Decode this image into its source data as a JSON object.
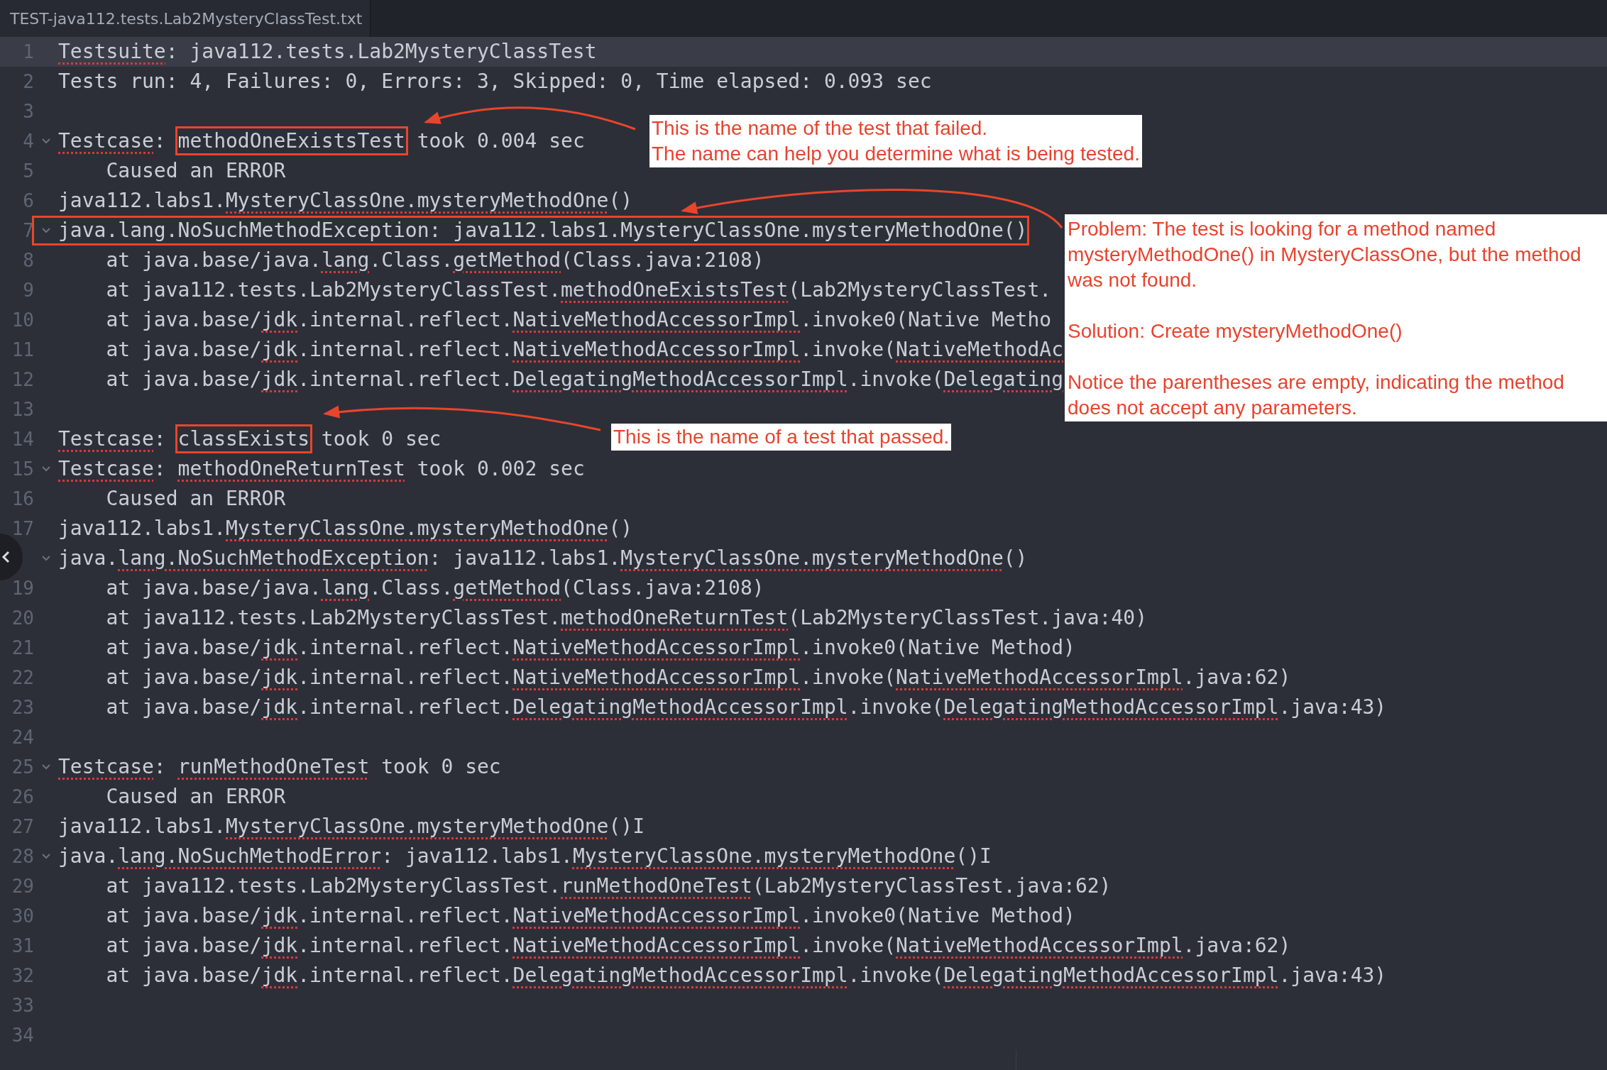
{
  "tab": {
    "title": "TEST-java112.tests.Lab2MysteryClassTest.txt",
    "selected": true
  },
  "lines": [
    {
      "number": "1",
      "current": true,
      "foldable": false,
      "highlighted": false,
      "segments": [
        {
          "kind": "misspelled",
          "text": "Testsuite"
        },
        {
          "kind": "plain",
          "text": ": java112.tests.Lab2MysteryClassTest"
        }
      ]
    },
    {
      "number": "2",
      "current": false,
      "foldable": false,
      "highlighted": false,
      "segments": [
        {
          "kind": "plain",
          "text": "Tests run: 4, Failures: 0, Errors: 3, Skipped: 0, Time elapsed: 0.093 sec"
        }
      ]
    },
    {
      "number": "3",
      "current": false,
      "foldable": false,
      "highlighted": false
    },
    {
      "number": "4",
      "current": false,
      "foldable": true,
      "highlighted": false,
      "segments": [
        {
          "kind": "misspelled",
          "text": "Testcase"
        },
        {
          "kind": "plain",
          "text": ": "
        },
        {
          "kind": "boxed",
          "text": "methodOneExistsTest"
        },
        {
          "kind": "plain",
          "text": " took 0.004 sec"
        }
      ]
    },
    {
      "number": "5",
      "current": false,
      "foldable": false,
      "highlighted": false,
      "segments": [
        {
          "kind": "plain",
          "text": "    Caused an ERROR"
        }
      ]
    },
    {
      "number": "6",
      "current": false,
      "foldable": false,
      "highlighted": false,
      "segments": [
        {
          "kind": "plain",
          "text": "java112.labs1."
        },
        {
          "kind": "misspelled",
          "text": "MysteryClassOne.mysteryMethodOne"
        },
        {
          "kind": "plain",
          "text": "()"
        }
      ]
    },
    {
      "number": "7",
      "current": false,
      "foldable": true,
      "highlighted": true,
      "segments": [
        {
          "kind": "plain",
          "text": "java.lang.NoSuchMethodException: java112.labs1.MysteryClassOne.mysteryMethodOne()"
        }
      ]
    },
    {
      "number": "8",
      "current": false,
      "foldable": false,
      "highlighted": false,
      "segments": [
        {
          "kind": "plain",
          "text": "    at java.base/java."
        },
        {
          "kind": "misspelled",
          "text": "lang"
        },
        {
          "kind": "plain",
          "text": ".Class."
        },
        {
          "kind": "misspelled",
          "text": "getMethod"
        },
        {
          "kind": "plain",
          "text": "(Class.java:2108)"
        }
      ]
    },
    {
      "number": "9",
      "current": false,
      "foldable": false,
      "highlighted": false,
      "segments": [
        {
          "kind": "plain",
          "text": "    at java112.tests.Lab2MysteryClassTest."
        },
        {
          "kind": "misspelled",
          "text": "methodOneExistsTest"
        },
        {
          "kind": "plain",
          "text": "(Lab2MysteryClassTest."
        }
      ]
    },
    {
      "number": "10",
      "current": false,
      "foldable": false,
      "highlighted": false,
      "segments": [
        {
          "kind": "plain",
          "text": "    at java.base/"
        },
        {
          "kind": "misspelled",
          "text": "jdk"
        },
        {
          "kind": "plain",
          "text": ".internal.reflect."
        },
        {
          "kind": "misspelled",
          "text": "NativeMethodAccessorImpl"
        },
        {
          "kind": "plain",
          "text": ".invoke0(Native Metho"
        }
      ]
    },
    {
      "number": "11",
      "current": false,
      "foldable": false,
      "highlighted": false,
      "segments": [
        {
          "kind": "plain",
          "text": "    at java.base/"
        },
        {
          "kind": "misspelled",
          "text": "jdk"
        },
        {
          "kind": "plain",
          "text": ".internal.reflect."
        },
        {
          "kind": "misspelled",
          "text": "NativeMethodAccessorImpl"
        },
        {
          "kind": "plain",
          "text": ".invoke("
        },
        {
          "kind": "misspelled",
          "text": "NativeMethodAc"
        }
      ]
    },
    {
      "number": "12",
      "current": false,
      "foldable": false,
      "highlighted": false,
      "segments": [
        {
          "kind": "plain",
          "text": "    at java.base/"
        },
        {
          "kind": "misspelled",
          "text": "jdk"
        },
        {
          "kind": "plain",
          "text": ".internal.reflect."
        },
        {
          "kind": "misspelled",
          "text": "DelegatingMethodAccessorImpl"
        },
        {
          "kind": "plain",
          "text": ".invoke("
        },
        {
          "kind": "misspelled",
          "text": "Delegating"
        }
      ]
    },
    {
      "number": "13",
      "current": false,
      "foldable": false,
      "highlighted": false
    },
    {
      "number": "14",
      "current": false,
      "foldable": false,
      "highlighted": false,
      "segments": [
        {
          "kind": "misspelled",
          "text": "Testcase"
        },
        {
          "kind": "plain",
          "text": ": "
        },
        {
          "kind": "boxed",
          "text": "classExists"
        },
        {
          "kind": "plain",
          "text": " took 0 sec"
        }
      ]
    },
    {
      "number": "15",
      "current": false,
      "foldable": true,
      "highlighted": false,
      "segments": [
        {
          "kind": "misspelled",
          "text": "Testcase"
        },
        {
          "kind": "plain",
          "text": ": "
        },
        {
          "kind": "misspelled",
          "text": "methodOneReturnTest"
        },
        {
          "kind": "plain",
          "text": " took 0.002 sec"
        }
      ]
    },
    {
      "number": "16",
      "current": false,
      "foldable": false,
      "highlighted": false,
      "segments": [
        {
          "kind": "plain",
          "text": "    Caused an ERROR"
        }
      ]
    },
    {
      "number": "17",
      "current": false,
      "foldable": false,
      "highlighted": false,
      "segments": [
        {
          "kind": "plain",
          "text": "java112.labs1."
        },
        {
          "kind": "misspelled",
          "text": "MysteryClassOne.mysteryMethodOne"
        },
        {
          "kind": "plain",
          "text": "()"
        }
      ]
    },
    {
      "current": false,
      "foldable": true,
      "highlighted": false,
      "segments": [
        {
          "kind": "plain",
          "text": "java."
        },
        {
          "kind": "misspelled",
          "text": "lang.NoSuchMethodException"
        },
        {
          "kind": "plain",
          "text": ": java112.labs1."
        },
        {
          "kind": "misspelled",
          "text": "MysteryClassOne.mysteryMethodOne"
        },
        {
          "kind": "plain",
          "text": "()"
        }
      ]
    },
    {
      "number": "19",
      "current": false,
      "foldable": false,
      "highlighted": false,
      "segments": [
        {
          "kind": "plain",
          "text": "    at java.base/java."
        },
        {
          "kind": "misspelled",
          "text": "lang"
        },
        {
          "kind": "plain",
          "text": ".Class."
        },
        {
          "kind": "misspelled",
          "text": "getMethod"
        },
        {
          "kind": "plain",
          "text": "(Class.java:2108)"
        }
      ]
    },
    {
      "number": "20",
      "current": false,
      "foldable": false,
      "highlighted": false,
      "segments": [
        {
          "kind": "plain",
          "text": "    at java112.tests.Lab2MysteryClassTest."
        },
        {
          "kind": "misspelled",
          "text": "methodOneReturnTest"
        },
        {
          "kind": "plain",
          "text": "(Lab2MysteryClassTest.java:40)"
        }
      ]
    },
    {
      "number": "21",
      "current": false,
      "foldable": false,
      "highlighted": false,
      "segments": [
        {
          "kind": "plain",
          "text": "    at java.base/"
        },
        {
          "kind": "misspelled",
          "text": "jdk"
        },
        {
          "kind": "plain",
          "text": ".internal.reflect."
        },
        {
          "kind": "misspelled",
          "text": "NativeMethodAccessorImpl"
        },
        {
          "kind": "plain",
          "text": ".invoke0(Native Method)"
        }
      ]
    },
    {
      "number": "22",
      "current": false,
      "foldable": false,
      "highlighted": false,
      "segments": [
        {
          "kind": "plain",
          "text": "    at java.base/"
        },
        {
          "kind": "misspelled",
          "text": "jdk"
        },
        {
          "kind": "plain",
          "text": ".internal.reflect."
        },
        {
          "kind": "misspelled",
          "text": "NativeMethodAccessorImpl"
        },
        {
          "kind": "plain",
          "text": ".invoke("
        },
        {
          "kind": "misspelled",
          "text": "NativeMethodAccessorImpl"
        },
        {
          "kind": "plain",
          "text": ".java:62)"
        }
      ]
    },
    {
      "number": "23",
      "current": false,
      "foldable": false,
      "highlighted": false,
      "segments": [
        {
          "kind": "plain",
          "text": "    at java.base/"
        },
        {
          "kind": "misspelled",
          "text": "jdk"
        },
        {
          "kind": "plain",
          "text": ".internal.reflect."
        },
        {
          "kind": "misspelled",
          "text": "DelegatingMethodAccessorImpl"
        },
        {
          "kind": "plain",
          "text": ".invoke("
        },
        {
          "kind": "misspelled",
          "text": "DelegatingMethodAccessorImpl"
        },
        {
          "kind": "plain",
          "text": ".java:43)"
        }
      ]
    },
    {
      "number": "24",
      "current": false,
      "foldable": false,
      "highlighted": false
    },
    {
      "number": "25",
      "current": false,
      "foldable": true,
      "highlighted": false,
      "segments": [
        {
          "kind": "misspelled",
          "text": "Testcase"
        },
        {
          "kind": "plain",
          "text": ": "
        },
        {
          "kind": "misspelled",
          "text": "runMethodOneTest"
        },
        {
          "kind": "plain",
          "text": " took 0 sec"
        }
      ]
    },
    {
      "number": "26",
      "current": false,
      "foldable": false,
      "highlighted": false,
      "segments": [
        {
          "kind": "plain",
          "text": "    Caused an ERROR"
        }
      ]
    },
    {
      "number": "27",
      "current": false,
      "foldable": false,
      "highlighted": false,
      "segments": [
        {
          "kind": "plain",
          "text": "java112.labs1."
        },
        {
          "kind": "misspelled",
          "text": "MysteryClassOne.mysteryMethodOne"
        },
        {
          "kind": "plain",
          "text": "()I"
        }
      ]
    },
    {
      "number": "28",
      "current": false,
      "foldable": true,
      "highlighted": false,
      "segments": [
        {
          "kind": "plain",
          "text": "java."
        },
        {
          "kind": "misspelled",
          "text": "lang.NoSuchMethodError"
        },
        {
          "kind": "plain",
          "text": ": java112.labs1."
        },
        {
          "kind": "misspelled",
          "text": "MysteryClassOne.mysteryMethodOne"
        },
        {
          "kind": "plain",
          "text": "()I"
        }
      ]
    },
    {
      "number": "29",
      "current": false,
      "foldable": false,
      "highlighted": false,
      "segments": [
        {
          "kind": "plain",
          "text": "    at java112.tests.Lab2MysteryClassTest."
        },
        {
          "kind": "misspelled",
          "text": "runMethodOneTest"
        },
        {
          "kind": "plain",
          "text": "(Lab2MysteryClassTest.java:62)"
        }
      ]
    },
    {
      "number": "30",
      "current": false,
      "foldable": false,
      "highlighted": false,
      "segments": [
        {
          "kind": "plain",
          "text": "    at java.base/"
        },
        {
          "kind": "misspelled",
          "text": "jdk"
        },
        {
          "kind": "plain",
          "text": ".internal.reflect."
        },
        {
          "kind": "misspelled",
          "text": "NativeMethodAccessorImpl"
        },
        {
          "kind": "plain",
          "text": ".invoke0(Native Method)"
        }
      ]
    },
    {
      "number": "31",
      "current": false,
      "foldable": false,
      "highlighted": false,
      "segments": [
        {
          "kind": "plain",
          "text": "    at java.base/"
        },
        {
          "kind": "misspelled",
          "text": "jdk"
        },
        {
          "kind": "plain",
          "text": ".internal.reflect."
        },
        {
          "kind": "misspelled",
          "text": "NativeMethodAccessorImpl"
        },
        {
          "kind": "plain",
          "text": ".invoke("
        },
        {
          "kind": "misspelled",
          "text": "NativeMethodAccessorImpl"
        },
        {
          "kind": "plain",
          "text": ".java:62)"
        }
      ]
    },
    {
      "number": "32",
      "current": false,
      "foldable": false,
      "highlighted": false,
      "segments": [
        {
          "kind": "plain",
          "text": "    at java.base/"
        },
        {
          "kind": "misspelled",
          "text": "jdk"
        },
        {
          "kind": "plain",
          "text": ".internal.reflect."
        },
        {
          "kind": "misspelled",
          "text": "DelegatingMethodAccessorImpl"
        },
        {
          "kind": "plain",
          "text": ".invoke("
        },
        {
          "kind": "misspelled",
          "text": "DelegatingMethodAccessorImpl"
        },
        {
          "kind": "plain",
          "text": ".java:43)"
        }
      ]
    },
    {
      "number": "33",
      "current": false,
      "foldable": false,
      "highlighted": false
    },
    {
      "number": "34",
      "current": false,
      "foldable": false,
      "highlighted": false
    }
  ],
  "annotations": [
    {
      "paragraphs": [
        "This is the name of the test that failed.",
        "The name can help you determine what is being tested."
      ]
    },
    {
      "paragraphs": [
        "Problem: The test is looking for a method named mysteryMethodOne() in MysteryClassOne, but the method was not found.",
        "Solution: Create mysteryMethodOne()",
        "Notice the parentheses are empty, indicating the method does not accept any parameters."
      ]
    },
    {
      "paragraphs": [
        "This is the name of a test that passed."
      ]
    }
  ]
}
